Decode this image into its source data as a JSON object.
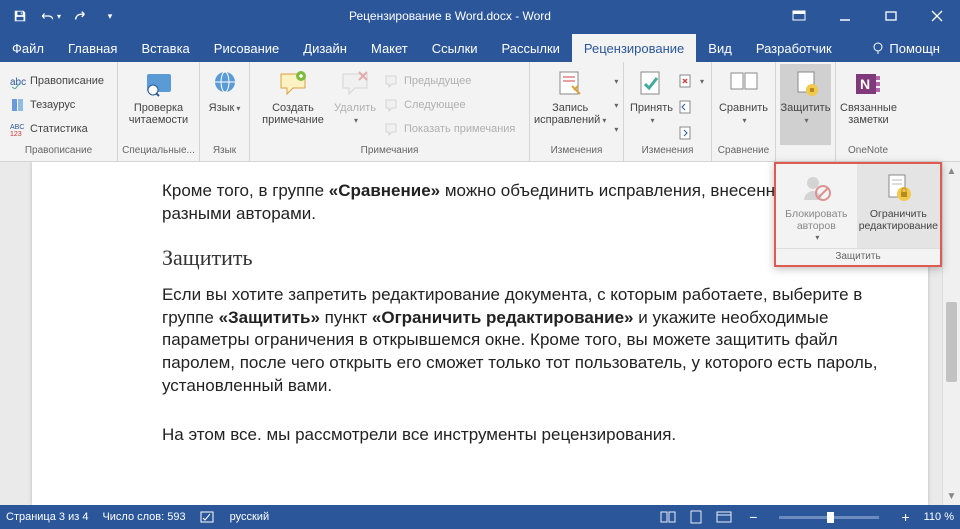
{
  "app": {
    "title": "Рецензирование в Word.docx  -  Word"
  },
  "tabs": {
    "file": "Файл",
    "home": "Главная",
    "insert": "Вставка",
    "draw": "Рисование",
    "design": "Дизайн",
    "layout": "Макет",
    "references": "Ссылки",
    "mailings": "Рассылки",
    "review": "Рецензирование",
    "view": "Вид",
    "developer": "Разработчик",
    "help": "Помощн"
  },
  "ribbon": {
    "proofing": {
      "spelling": "Правописание",
      "thesaurus": "Тезаурус",
      "stats": "Статистика",
      "label": "Правописание"
    },
    "special": {
      "readability": "Проверка\nчитаемости",
      "label": "Специальные..."
    },
    "language": {
      "language": "Язык",
      "label": "Язык"
    },
    "comments": {
      "new": "Создать\nпримечание",
      "delete": "Удалить",
      "prev": "Предыдущее",
      "next": "Следующее",
      "show": "Показать примечания",
      "label": "Примечания"
    },
    "tracking": {
      "track": "Запись\nисправлений",
      "label": "Изменения"
    },
    "changes": {
      "accept": "Принять",
      "label": "Изменения"
    },
    "compare": {
      "compare": "Сравнить",
      "label": "Сравнение"
    },
    "protect": {
      "protect": "Защитить",
      "label": ""
    },
    "onenote": {
      "linked": "Связанные\nзаметки",
      "label": "OneNote"
    }
  },
  "popout": {
    "block": "Блокировать\nавторов",
    "restrict": "Ограничить\nредактирование",
    "label": "Защитить"
  },
  "document": {
    "p1a": "Кроме того, в группе ",
    "p1b": "«Сравнение»",
    "p1c": " можно объединить исправления, внесенные двумя разными авторами.",
    "h1": "Защитить",
    "p2a": "Если вы хотите запретить редактирование документа, с которым работаете, выберите в группе ",
    "p2b": "«Защитить»",
    "p2c": " пункт ",
    "p2d": "«Ограничить редактирование»",
    "p2e": " и укажите необходимые параметры ограничения в открывшемся окне. Кроме того, вы можете защитить файл паролем, после чего открыть его сможет только тот пользователь, у которого есть пароль, установленный вами.",
    "p3": "На этом все. мы рассмотрели все инструменты рецензирования."
  },
  "status": {
    "page": "Страница 3 из 4",
    "words": "Число слов: 593",
    "lang": "русский",
    "zoom": "110 %"
  }
}
